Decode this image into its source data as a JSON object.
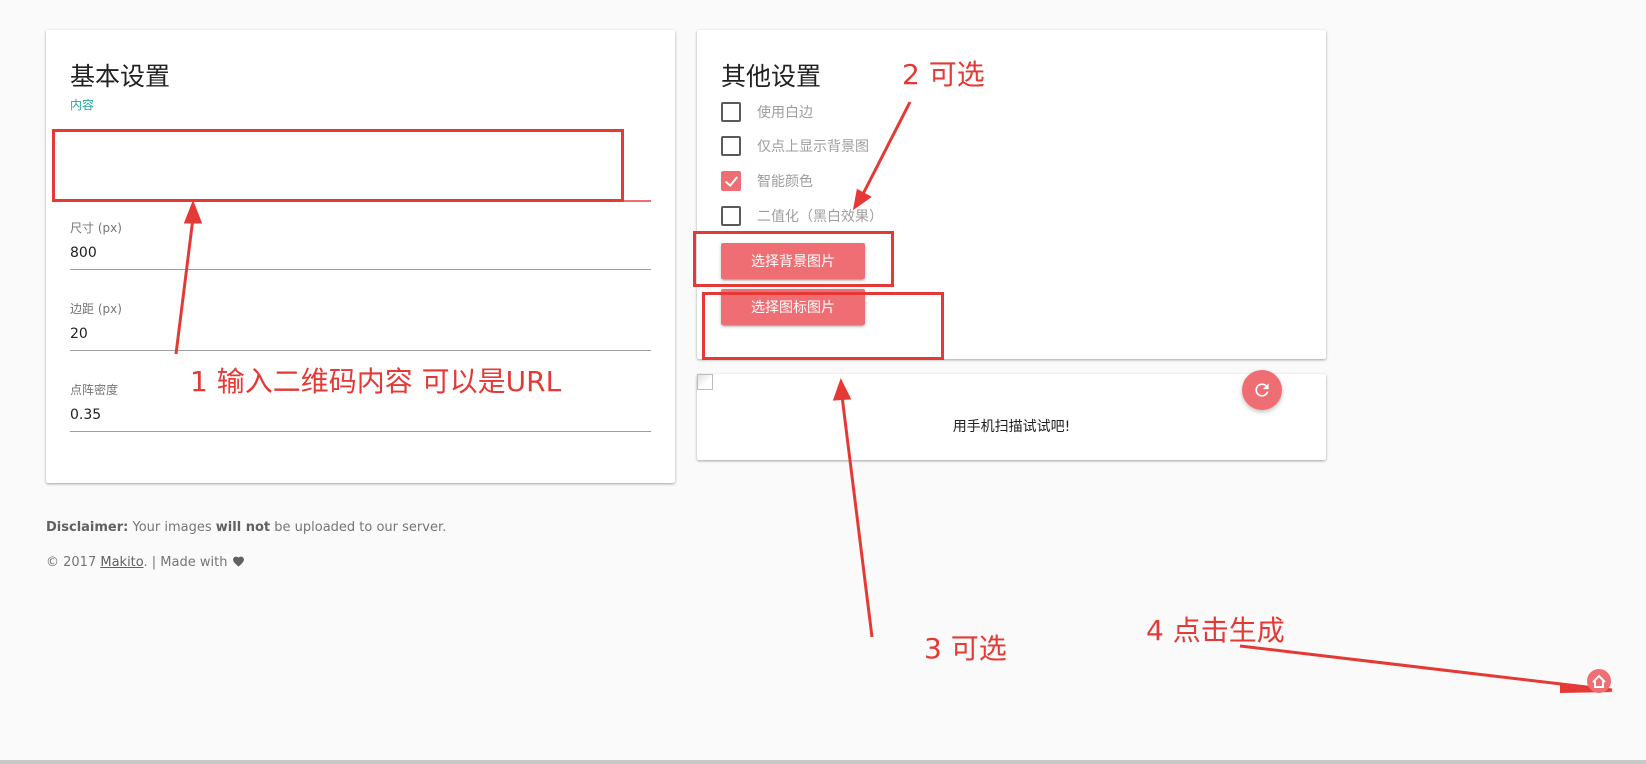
{
  "basic_settings": {
    "title": "基本设置",
    "content_label": "内容",
    "content_value": "",
    "size_label": "尺寸 (px)",
    "size_value": "800",
    "margin_label": "边距 (px)",
    "margin_value": "20",
    "dot_density_label": "点阵密度",
    "dot_density_value": "0.35"
  },
  "other_settings": {
    "title": "其他设置",
    "checkboxes": [
      {
        "label": "使用白边",
        "checked": false
      },
      {
        "label": "仅点上显示背景图",
        "checked": false
      },
      {
        "label": "智能颜色",
        "checked": true
      },
      {
        "label": "二值化（黑白效果）",
        "checked": false
      }
    ],
    "bg_button": "选择背景图片",
    "icon_button": "选择图标图片"
  },
  "preview": {
    "text": "用手机扫描试试吧!",
    "refresh_icon": "refresh-icon",
    "image_icon": "broken-image-icon"
  },
  "footer": {
    "disclaimer_label": "Disclaimer:",
    "disclaimer_text_1": "Your images",
    "disclaimer_emphasis": "will not",
    "disclaimer_text_2": "be uploaded to our server.",
    "copyright_prefix": "© 2017",
    "author_link": "Makito",
    "copyright_suffix": ". | Made with",
    "heart_icon": "heart-icon"
  },
  "annotations": {
    "a1": "1 输入二维码内容 可以是URL",
    "a2": "2 可选",
    "a3": "3 可选",
    "a4": "4 点击生成"
  },
  "colors": {
    "accent": "#ee6e73",
    "teal": "#26a69a",
    "annotation": "#e53935",
    "background": "#fafafa"
  }
}
